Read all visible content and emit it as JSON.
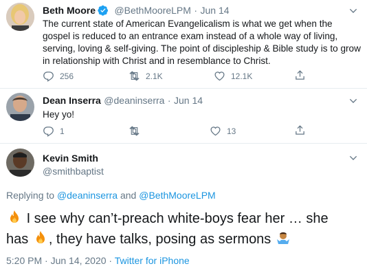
{
  "tweets": [
    {
      "name": "Beth Moore",
      "handle": "@BethMooreLPM",
      "date": "Jun 14",
      "text": "The current state of American Evangelicalism is what we get when the gospel is reduced to an entrance exam instead of a whole way of living, serving, loving & self-giving. The point of discipleship & Bible study is to grow in relationship with Christ and in resemblance to Christ.",
      "replies": "256",
      "retweets": "2.1K",
      "likes": "12.1K"
    },
    {
      "name": "Dean Inserra",
      "handle": "@deaninserra",
      "date": "Jun 14",
      "text": "Hey yo!",
      "replies": "1",
      "retweets": "",
      "likes": "13"
    }
  ],
  "main_tweet": {
    "name": "Kevin Smith",
    "handle": "@smithbaptist",
    "replying_prefix": "Replying to ",
    "reply_to_1": "@deaninserra",
    "reply_and": " and ",
    "reply_to_2": "@BethMooreLPM",
    "text_line1": "I see why can’t-preach white-boys fear her … she",
    "text_line2_a": "has",
    "text_line2_b": ", they have talks, posing as sermons",
    "timestamp": "5:20 PM · Jun 14, 2020 · ",
    "source": "Twitter for iPhone"
  },
  "separator": "·",
  "colors": {
    "accent": "#1da1f2",
    "link": "#1b95e0",
    "muted": "#657786"
  }
}
